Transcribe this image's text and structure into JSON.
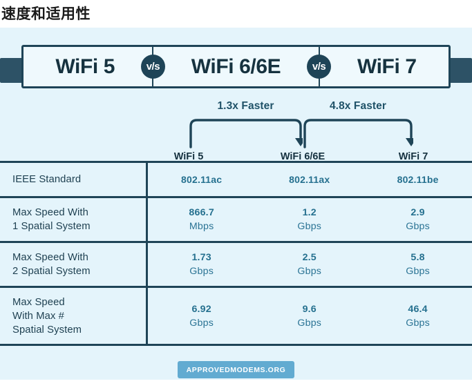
{
  "page": {
    "title": "速度和适用性"
  },
  "colors": {
    "background": "#e4f4fb",
    "ink": "#1e4457",
    "accent": "#25708f",
    "brand_badge": "#62abd1",
    "banner_fill": "#eff9fd"
  },
  "banner": {
    "left_label": "WiFi 5",
    "middle_label": "WiFi 6/6E",
    "right_label": "WiFi 7",
    "vs_badge_1": "v/s",
    "vs_badge_2": "v/s"
  },
  "arrows": [
    {
      "label": "1.3x Faster",
      "from": "WiFi 5",
      "to": "WiFi 6/6E"
    },
    {
      "label": "4.8x Faster",
      "from": "WiFi 6/6E",
      "to": "WiFi 7"
    }
  ],
  "column_headers": [
    "WiFi 5",
    "WiFi 6/6E",
    "WiFi 7"
  ],
  "table": {
    "rows": [
      {
        "label": "IEEE Standard",
        "values": [
          {
            "value": "802.11ac",
            "unit": ""
          },
          {
            "value": "802.11ax",
            "unit": ""
          },
          {
            "value": "802.11be",
            "unit": ""
          }
        ]
      },
      {
        "label": "Max Speed With\n1 Spatial System",
        "label_line1": "Max Speed With",
        "label_line2": "1 Spatial System",
        "label_line3": "",
        "values": [
          {
            "value": "866.7",
            "unit": "Mbps"
          },
          {
            "value": "1.2",
            "unit": "Gbps"
          },
          {
            "value": "2.9",
            "unit": "Gbps"
          }
        ]
      },
      {
        "label_line1": "Max Speed With",
        "label_line2": "2 Spatial System",
        "label_line3": "",
        "values": [
          {
            "value": "1.73",
            "unit": "Gbps"
          },
          {
            "value": "2.5",
            "unit": "Gbps"
          },
          {
            "value": "5.8",
            "unit": "Gbps"
          }
        ]
      },
      {
        "label_line1": "Max Speed",
        "label_line2": "With Max #",
        "label_line3": "Spatial System",
        "values": [
          {
            "value": "6.92",
            "unit": "Gbps"
          },
          {
            "value": "9.6",
            "unit": "Gbps"
          },
          {
            "value": "46.4",
            "unit": "Gbps"
          }
        ]
      }
    ]
  },
  "footer": {
    "brand": "APPROVEDMODEMS.ORG"
  }
}
